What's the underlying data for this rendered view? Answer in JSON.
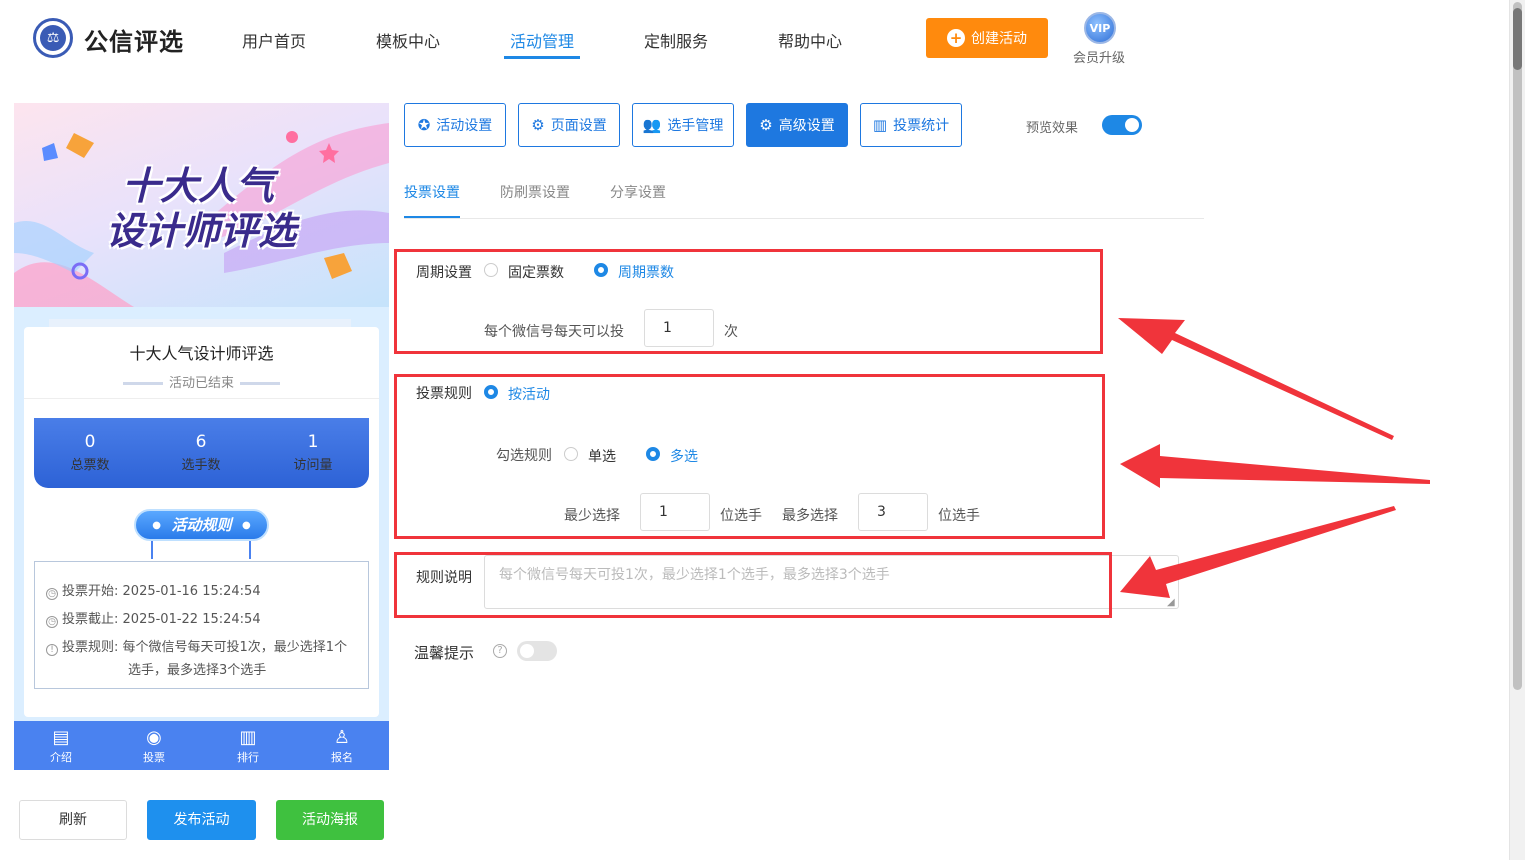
{
  "header": {
    "logo_text": "公信评选",
    "nav": [
      "用户首页",
      "模板中心",
      "活动管理",
      "定制服务",
      "帮助中心"
    ],
    "create_button": "创建活动",
    "vip_badge": "VIP",
    "vip_label": "会员升级"
  },
  "preview": {
    "banner_title_line1": "十大人气",
    "banner_title_line2": "设计师评选",
    "card_title": "十大人气设计师评选",
    "status": "活动已结束",
    "stats": [
      {
        "value": "0",
        "label": "总票数"
      },
      {
        "value": "6",
        "label": "选手数"
      },
      {
        "value": "1",
        "label": "访问量"
      }
    ],
    "rules_title": "活动规则",
    "rules": [
      {
        "label": "投票开始:",
        "value": "2025-01-16 15:24:54"
      },
      {
        "label": "投票截止:",
        "value": "2025-01-22 15:24:54"
      },
      {
        "label": "投票规则:",
        "value": "每个微信号每天可投1次，最少选择1个",
        "value2": "选手，最多选择3个选手"
      }
    ],
    "tabbar": [
      "介绍",
      "投票",
      "排行",
      "报名"
    ]
  },
  "bottom_buttons": {
    "refresh": "刷新",
    "publish": "发布活动",
    "poster": "活动海报"
  },
  "settings_buttons": [
    "活动设置",
    "页面设置",
    "选手管理",
    "高级设置",
    "投票统计"
  ],
  "preview_toggle_label": "预览效果",
  "subtabs": [
    "投票设置",
    "防刷票设置",
    "分享设置"
  ],
  "form": {
    "cycle_label": "周期设置",
    "cycle_options": [
      "固定票数",
      "周期票数"
    ],
    "per_day_label": "每个微信号每天可以投",
    "per_day_value": "1",
    "per_day_unit": "次",
    "rule_label": "投票规则",
    "rule_option": "按活动",
    "check_label": "勾选规则",
    "check_options": [
      "单选",
      "多选"
    ],
    "min_label": "最少选择",
    "min_value": "1",
    "min_unit": "位选手",
    "max_label": "最多选择",
    "max_value": "3",
    "max_unit": "位选手",
    "desc_label": "规则说明",
    "desc_placeholder": "每个微信号每天可投1次，最少选择1个选手，最多选择3个选手",
    "tips_label": "温馨提示"
  },
  "colors": {
    "accent": "#1e88e5",
    "annotation_red": "#f0343b",
    "orange": "#ff8a0d",
    "green": "#3fc13f"
  }
}
